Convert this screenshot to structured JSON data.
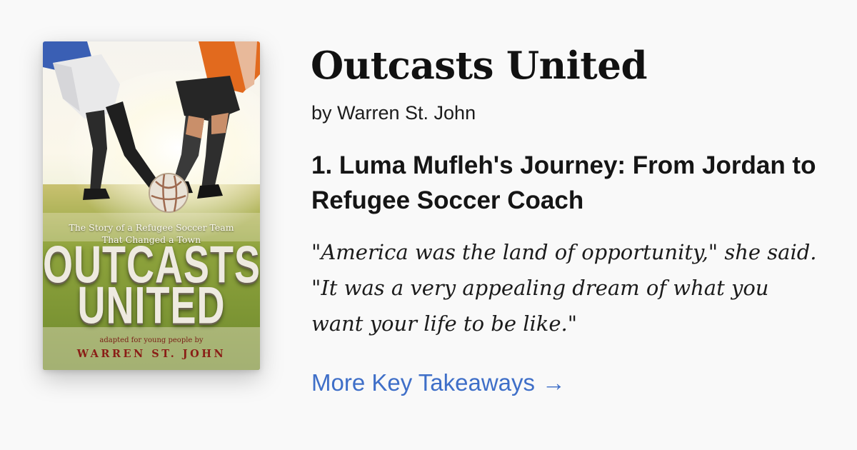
{
  "book": {
    "title": "Outcasts United",
    "byline": "by Warren St. John"
  },
  "cover": {
    "subtitle_line1": "The Story of a Refugee Soccer Team",
    "subtitle_line2": "That Changed a Town",
    "title_line1": "OUTCASTS",
    "title_line2": "UNITED",
    "adapted": "adapted for young people by",
    "author": "WARREN ST. JOHN"
  },
  "takeaway": {
    "heading": "1. Luma Mufleh's Journey: From Jordan to Refugee Soccer Coach",
    "quote": "\"America was the land of opportunity,\" she said. \"It was a very appealing dream of what you want your life to be like.\""
  },
  "link": {
    "label": "More Key Takeaways",
    "arrow": "→"
  },
  "colors": {
    "background": "#f9f9f9",
    "link": "#3f6fc8",
    "cover_author": "#8a1d16"
  }
}
